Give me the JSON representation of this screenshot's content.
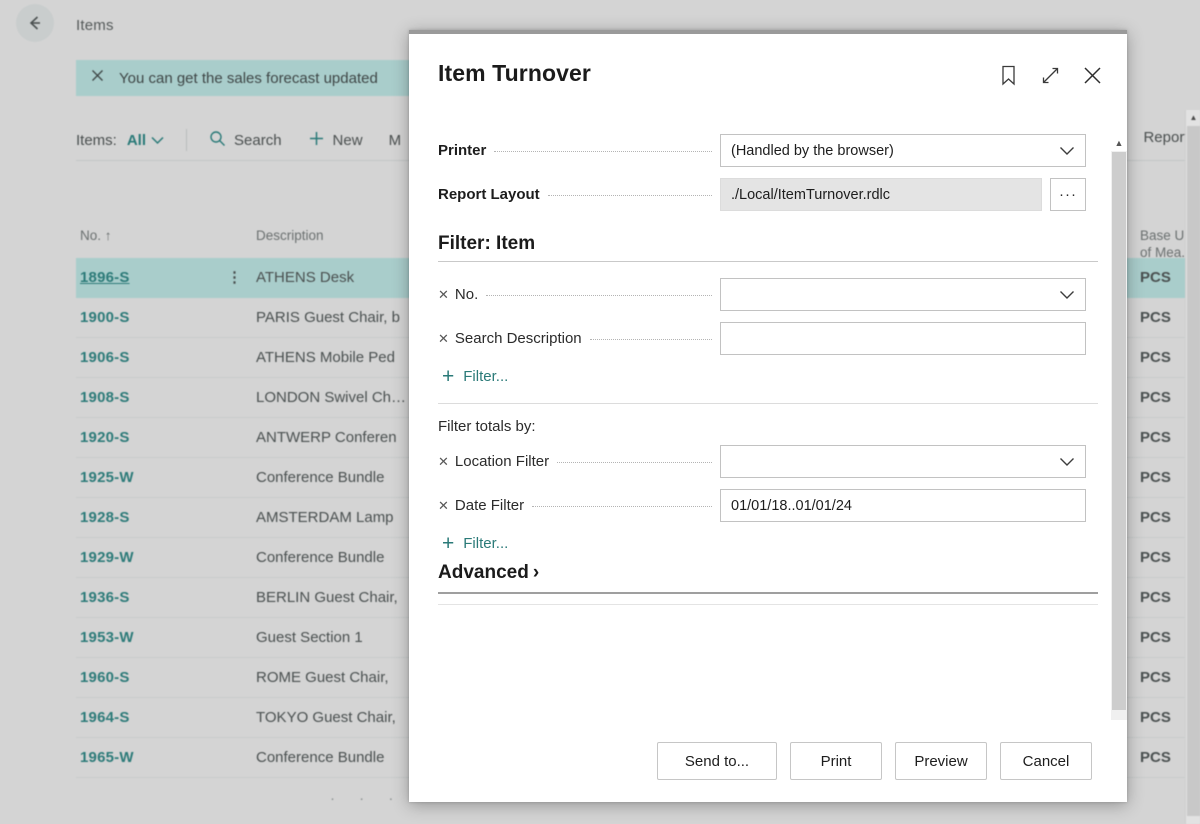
{
  "background": {
    "breadcrumb": "Items",
    "back_icon": "back-arrow-icon",
    "notification": {
      "close_icon": "close-icon",
      "text": "You can get the sales forecast updated"
    },
    "toolbar": {
      "items_label": "Items:",
      "view_value": "All",
      "chevron_icon": "chevron-down-icon",
      "search_icon": "search-icon",
      "search_label": "Search",
      "plus_icon": "plus-icon",
      "new_label": "New",
      "more_label": "M",
      "reports_label": "Reports"
    },
    "grid": {
      "columns": [
        "No. ↑",
        "Description",
        "Base Unit of Mea..."
      ],
      "kebab_icon": "more-options-icon",
      "rows": [
        {
          "no": "1896-S",
          "description": "ATHENS Desk",
          "unit": "PCS",
          "selected": true
        },
        {
          "no": "1900-S",
          "description": "PARIS Guest Chair, b",
          "unit": "PCS",
          "selected": false
        },
        {
          "no": "1906-S",
          "description": "ATHENS Mobile Ped",
          "unit": "PCS",
          "selected": false
        },
        {
          "no": "1908-S",
          "description": "LONDON Swivel Ch…",
          "unit": "PCS",
          "selected": false
        },
        {
          "no": "1920-S",
          "description": "ANTWERP Conferen",
          "unit": "PCS",
          "selected": false
        },
        {
          "no": "1925-W",
          "description": "Conference Bundle",
          "unit": "PCS",
          "selected": false
        },
        {
          "no": "1928-S",
          "description": "AMSTERDAM Lamp",
          "unit": "PCS",
          "selected": false
        },
        {
          "no": "1929-W",
          "description": "Conference Bundle",
          "unit": "PCS",
          "selected": false
        },
        {
          "no": "1936-S",
          "description": "BERLIN Guest Chair,",
          "unit": "PCS",
          "selected": false
        },
        {
          "no": "1953-W",
          "description": "Guest Section 1",
          "unit": "PCS",
          "selected": false
        },
        {
          "no": "1960-S",
          "description": "ROME Guest Chair, ",
          "unit": "PCS",
          "selected": false
        },
        {
          "no": "1964-S",
          "description": "TOKYO Guest Chair,",
          "unit": "PCS",
          "selected": false
        },
        {
          "no": "1965-W",
          "description": "Conference Bundle ",
          "unit": "PCS",
          "selected": false
        }
      ],
      "more_dots": "· · · ·"
    }
  },
  "dialog": {
    "title": "Item Turnover",
    "icons": {
      "bookmark": "bookmark-icon",
      "expand": "expand-icon",
      "close": "close-icon"
    },
    "printer": {
      "label": "Printer",
      "value": "(Handled by the browser)",
      "chevron_icon": "chevron-down-icon"
    },
    "report_layout": {
      "label": "Report Layout",
      "value": "./Local/ItemTurnover.rdlc",
      "ellipsis_label": "···"
    },
    "filter_item": {
      "heading": "Filter: Item",
      "rows": [
        {
          "label": "No.",
          "value": "",
          "placeholder": "",
          "has_chevron": true,
          "remove_icon": "remove-filter-icon"
        },
        {
          "label": "Search Description",
          "value": "",
          "placeholder": "",
          "has_chevron": false,
          "remove_icon": "remove-filter-icon"
        }
      ],
      "add_filter_label": "Filter...",
      "add_filter_plus": "+"
    },
    "filter_totals": {
      "heading": "Filter totals by:",
      "rows": [
        {
          "label": "Location Filter",
          "value": "",
          "placeholder": "",
          "has_chevron": true,
          "remove_icon": "remove-filter-icon"
        },
        {
          "label": "Date Filter",
          "value": "01/01/18..01/01/24",
          "placeholder": "",
          "has_chevron": false,
          "remove_icon": "remove-filter-icon"
        }
      ],
      "add_filter_label": "Filter...",
      "add_filter_plus": "+"
    },
    "advanced": {
      "label": "Advanced",
      "chevron_icon": "chevron-right-icon",
      "chevron_glyph": "›"
    },
    "footer": {
      "send_to": "Send to...",
      "print": "Print",
      "preview": "Preview",
      "cancel": "Cancel"
    },
    "scrollbar": {
      "up_icon": "scroll-up-icon",
      "down_icon": "scroll-down-icon",
      "up_glyph": "▲",
      "down_glyph": "▼"
    }
  },
  "colors": {
    "accent_teal": "#2a7a78",
    "highlight_teal": "#a9cdcb",
    "page_bg": "#d4d4d4"
  }
}
